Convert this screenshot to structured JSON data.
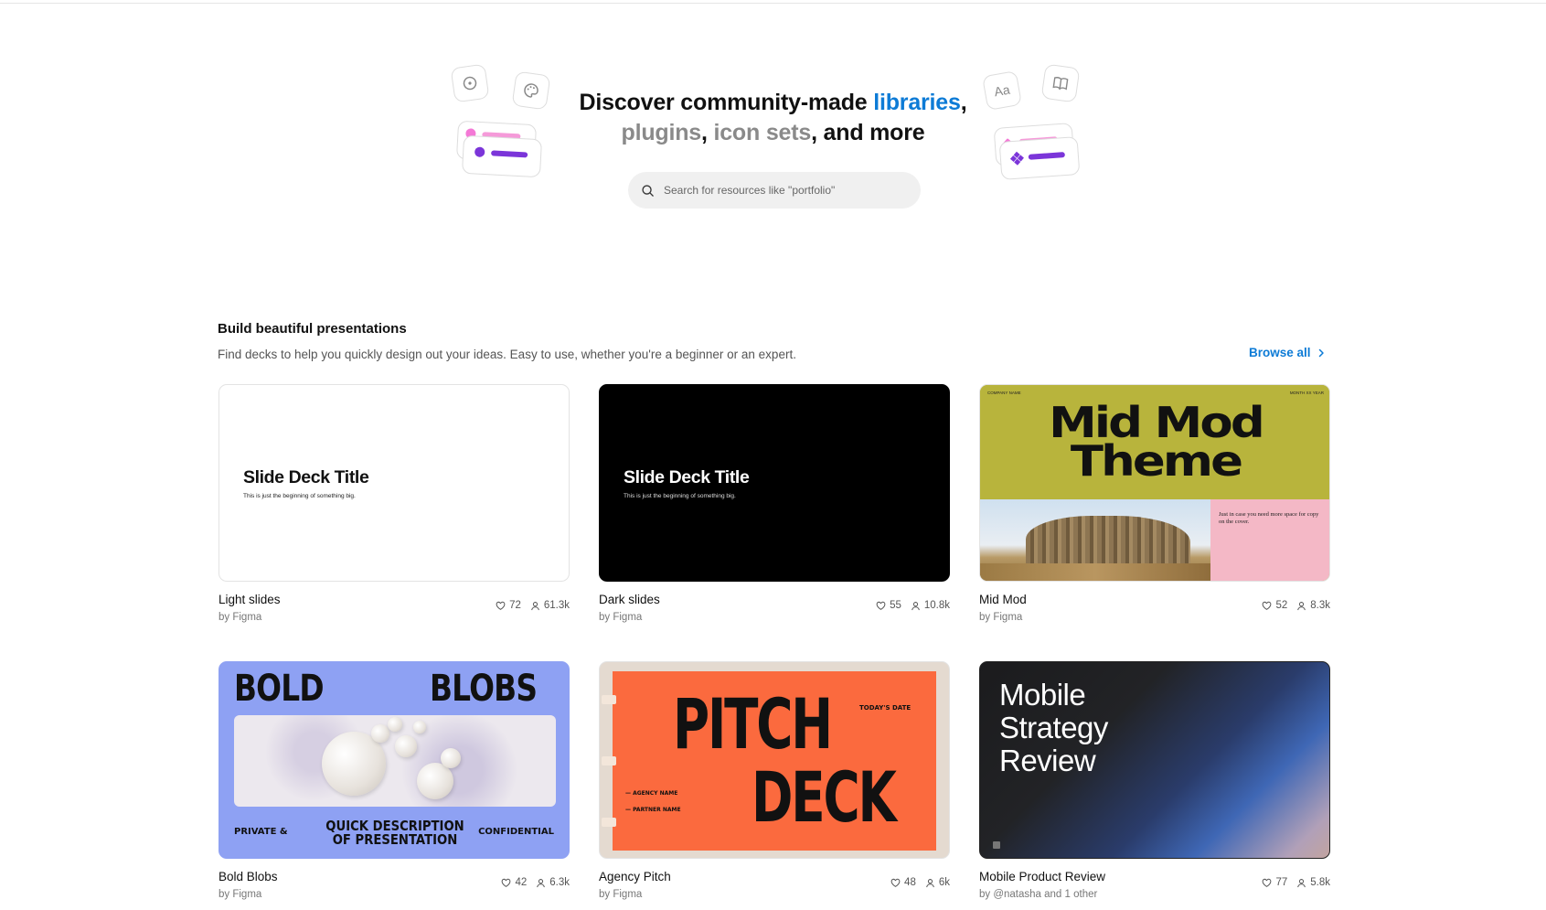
{
  "hero": {
    "title_part1": "Discover community-made ",
    "title_libraries": "libraries",
    "title_comma1": ",",
    "title_plugins": "plugins",
    "title_comma2": ", ",
    "title_iconsets": "icon sets",
    "title_end": ", and more",
    "search_placeholder": "Search for resources like \"portfolio\"",
    "deco_aa": "Aa"
  },
  "section": {
    "title": "Build beautiful presentations",
    "subtitle": "Find decks to help you quickly design out your ideas. Easy to use, whether you're a beginner or an expert.",
    "browse_label": "Browse all"
  },
  "cards": [
    {
      "name": "Light slides",
      "author": "by Figma",
      "likes": "72",
      "users": "61.3k",
      "thumb_title": "Slide Deck Title",
      "thumb_sub": "This is just the beginning of something big."
    },
    {
      "name": "Dark slides",
      "author": "by Figma",
      "likes": "55",
      "users": "10.8k",
      "thumb_title": "Slide Deck Title",
      "thumb_sub": "This is just the beginning of something big."
    },
    {
      "name": "Mid Mod",
      "author": "by Figma",
      "likes": "52",
      "users": "8.3k",
      "thumb_company": "COMPANY NAME",
      "thumb_date": "MONTH XX YEAR",
      "thumb_title_1": "Mid Mod",
      "thumb_title_2": "Theme",
      "thumb_note": "Just in case you need more space for copy on the cover."
    },
    {
      "name": "Bold Blobs",
      "author": "by Figma",
      "likes": "42",
      "users": "6.3k",
      "thumb_word1": "BOLD",
      "thumb_word2": "BLOBS",
      "thumb_left": "PRIVATE &",
      "thumb_center": "QUICK DESCRIPTION OF PRESENTATION",
      "thumb_right": "CONFIDENTIAL"
    },
    {
      "name": "Agency Pitch",
      "author": "by Figma",
      "likes": "48",
      "users": "6k",
      "thumb_word1": "PITCH",
      "thumb_word2": "DECK",
      "thumb_date": "TODAY'S DATE",
      "thumb_agency": "— AGENCY NAME",
      "thumb_partner": "— PARTNER NAME"
    },
    {
      "name": "Mobile Product Review",
      "author": "by @natasha and 1 other",
      "likes": "77",
      "users": "5.8k",
      "thumb_l1": "Mobile",
      "thumb_l2": "Strategy",
      "thumb_l3": "Review"
    }
  ],
  "colors": {
    "accent_blue": "#0d7bd6",
    "muted_gray": "#8a8a8a",
    "search_bg": "#f0f0f0"
  },
  "icons": [
    "search-icon",
    "heart-icon",
    "user-icon",
    "chevron-right-icon",
    "component-icon",
    "palette-icon",
    "book-icon"
  ]
}
